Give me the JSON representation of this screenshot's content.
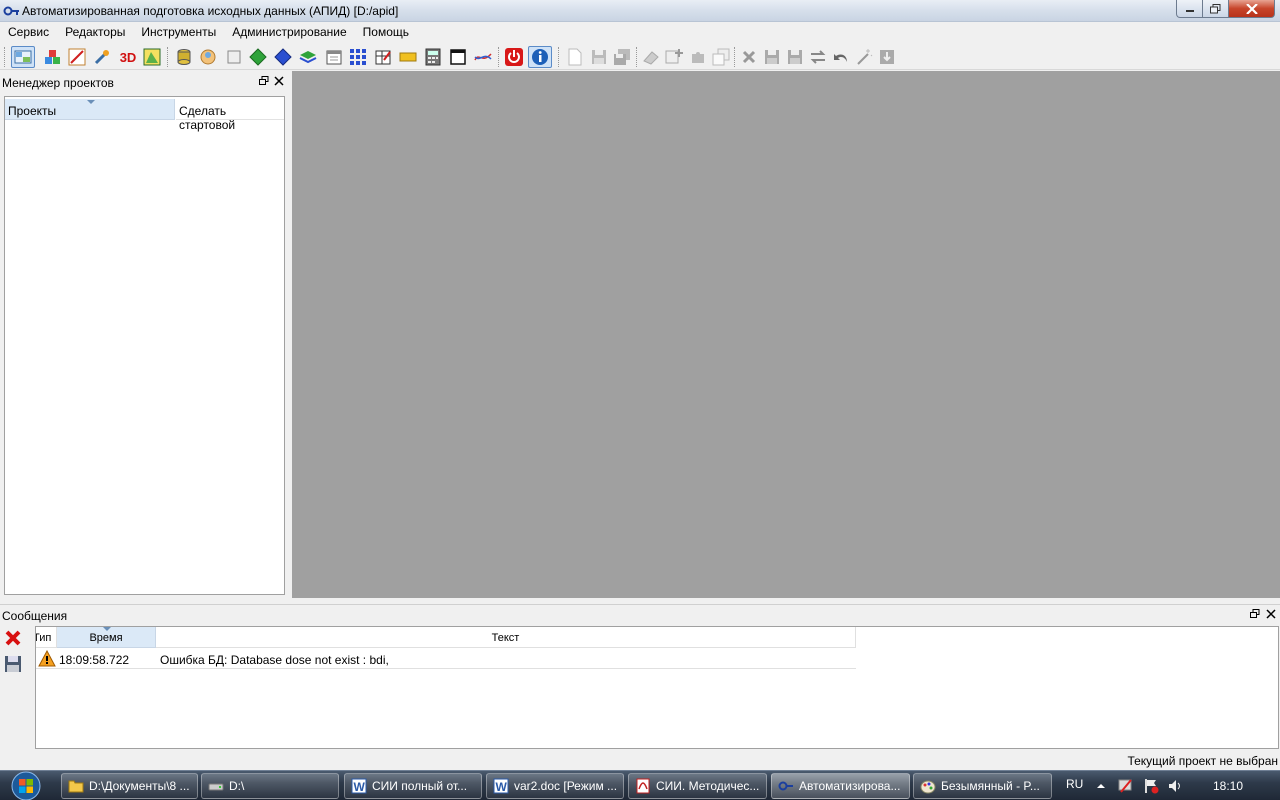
{
  "window": {
    "title": "Автоматизированная подготовка исходных данных (АПИД) [D:/apid]"
  },
  "menu": [
    "Сервис",
    "Редакторы",
    "Инструменты",
    "Администрирование",
    "Помощь"
  ],
  "toolbar": {
    "label_3d": "3D"
  },
  "project_manager": {
    "title": "Менеджер проектов",
    "columns": [
      "Проекты",
      "Сделать стартовой"
    ]
  },
  "messages": {
    "title": "Сообщения",
    "columns": {
      "type": "Тип",
      "time": "Время",
      "text": "Текст"
    },
    "rows": [
      {
        "icon": "warning-icon",
        "time": "18:09:58.722",
        "text": "Ошибка БД: Database dose not exist : bdi,"
      }
    ]
  },
  "status": {
    "text": "Текущий проект не выбран"
  },
  "taskbar": {
    "items": [
      {
        "label": "D:\\Документы\\8 ...",
        "icon": "folder-icon"
      },
      {
        "label": "D:\\",
        "icon": "drive-icon"
      },
      {
        "label": "СИИ полный от...",
        "icon": "word-icon"
      },
      {
        "label": "var2.doc [Режим ...",
        "icon": "word-icon"
      },
      {
        "label": "СИИ. Методичес...",
        "icon": "pdf-icon"
      },
      {
        "label": "Автоматизирова...",
        "icon": "apid-icon"
      },
      {
        "label": "Безымянный - P...",
        "icon": "paint-icon"
      }
    ],
    "lang": "RU",
    "clock": "18:10"
  },
  "colors": {
    "mdi_background": "#a0a0a0",
    "selected_header": "#dbe9f7",
    "taskbar": "#2e3a4a"
  }
}
